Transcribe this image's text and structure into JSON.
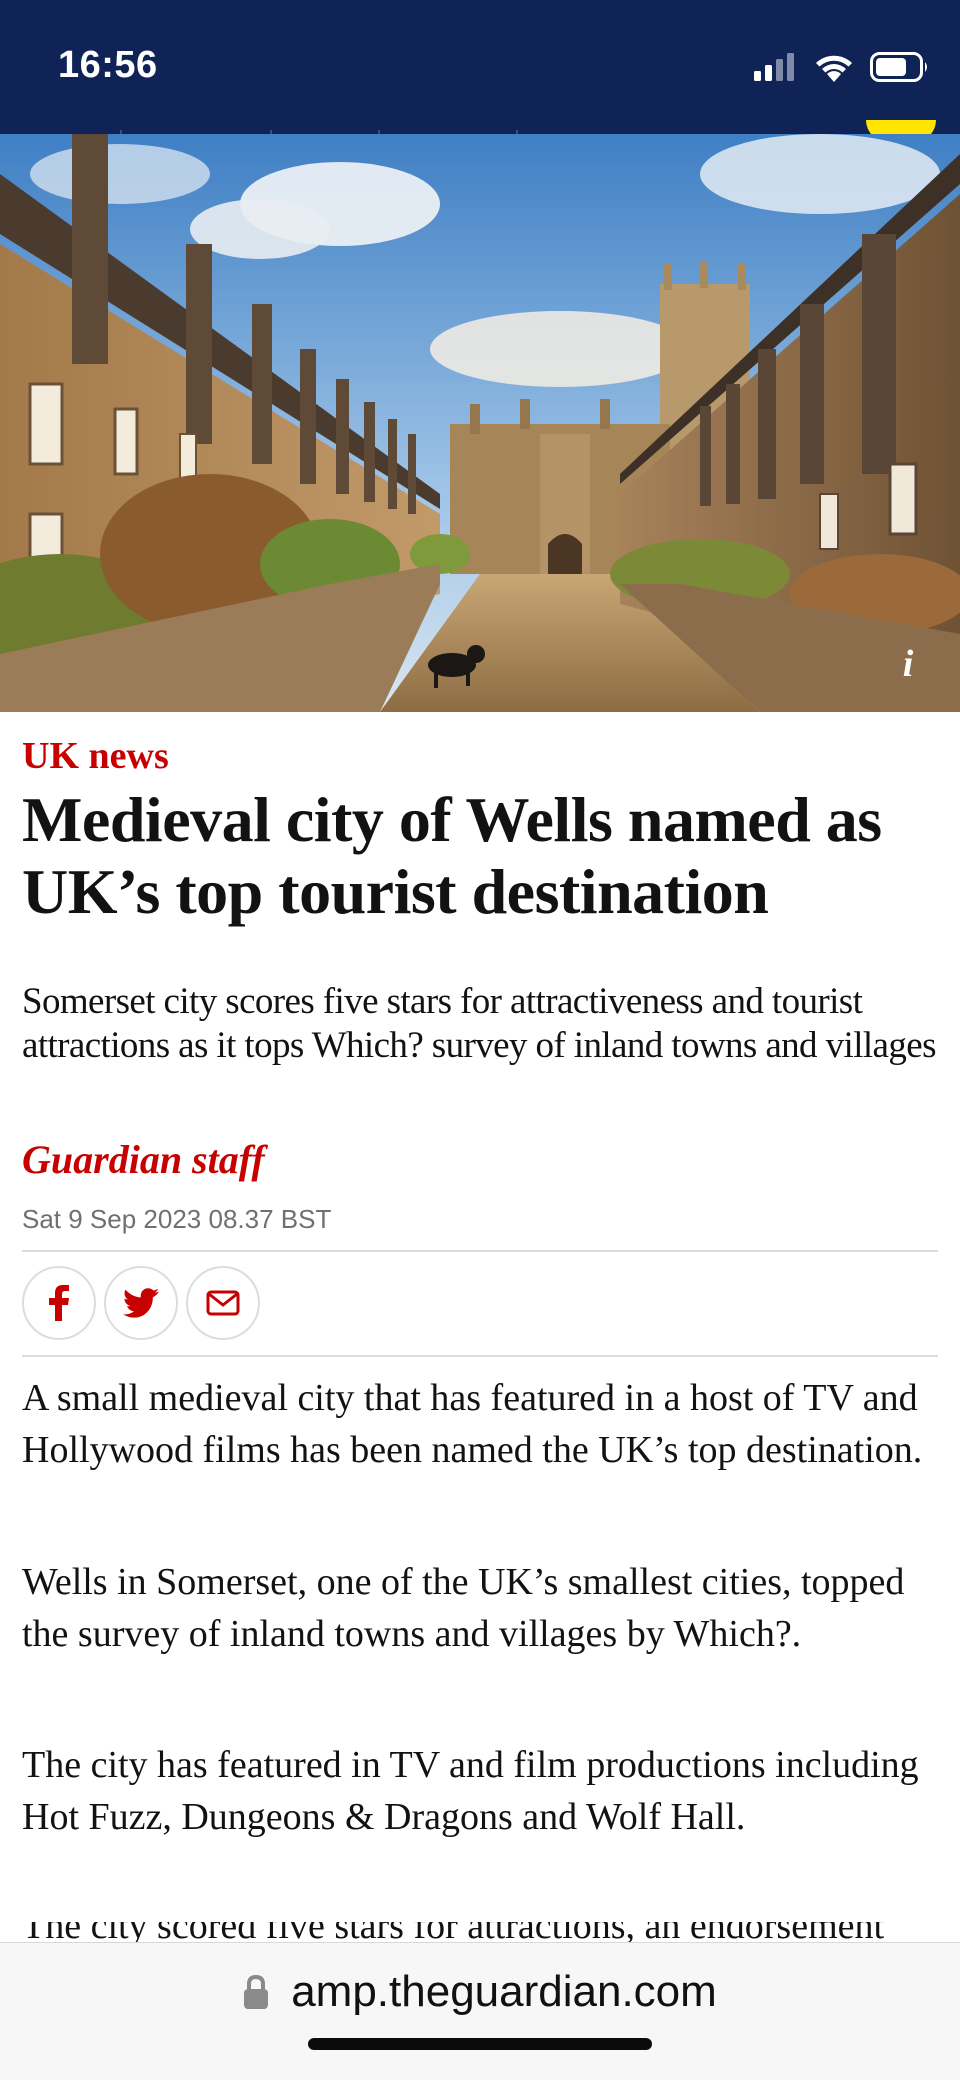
{
  "status_bar": {
    "time": "16:56",
    "icons": [
      "signal-icon",
      "wifi-icon",
      "battery-icon"
    ]
  },
  "hero": {
    "alt": "Vicars' Close, Wells",
    "info_label": "i"
  },
  "article": {
    "section": "UK news",
    "headline": "Medieval city of Wells named as UK’s top tourist destination",
    "standfirst": "Somerset city scores five stars for attractiveness and tourist attractions as it tops Which? survey of inland towns and villages",
    "byline": "Guardian staff",
    "date": "Sat 9 Sep 2023 08.37 BST",
    "share": [
      "facebook-icon",
      "twitter-icon",
      "email-icon"
    ],
    "paragraphs": [
      "A small medieval city that has featured in a host of TV and Hollywood films has been named the UK’s top destination.",
      "Wells in Somerset, one of the UK’s smallest cities, topped the survey of inland towns and villages by Which?.",
      "The city has featured in TV and film productions including Hot Fuzz, Dungeons & Dragons and Wolf Hall.",
      "The city scored five stars for attractions, an endorsement"
    ]
  },
  "browser": {
    "url": "amp.theguardian.com"
  },
  "colors": {
    "brand_navy": "#0f2356",
    "news_red": "#c70000",
    "yellow": "#ffe500"
  }
}
